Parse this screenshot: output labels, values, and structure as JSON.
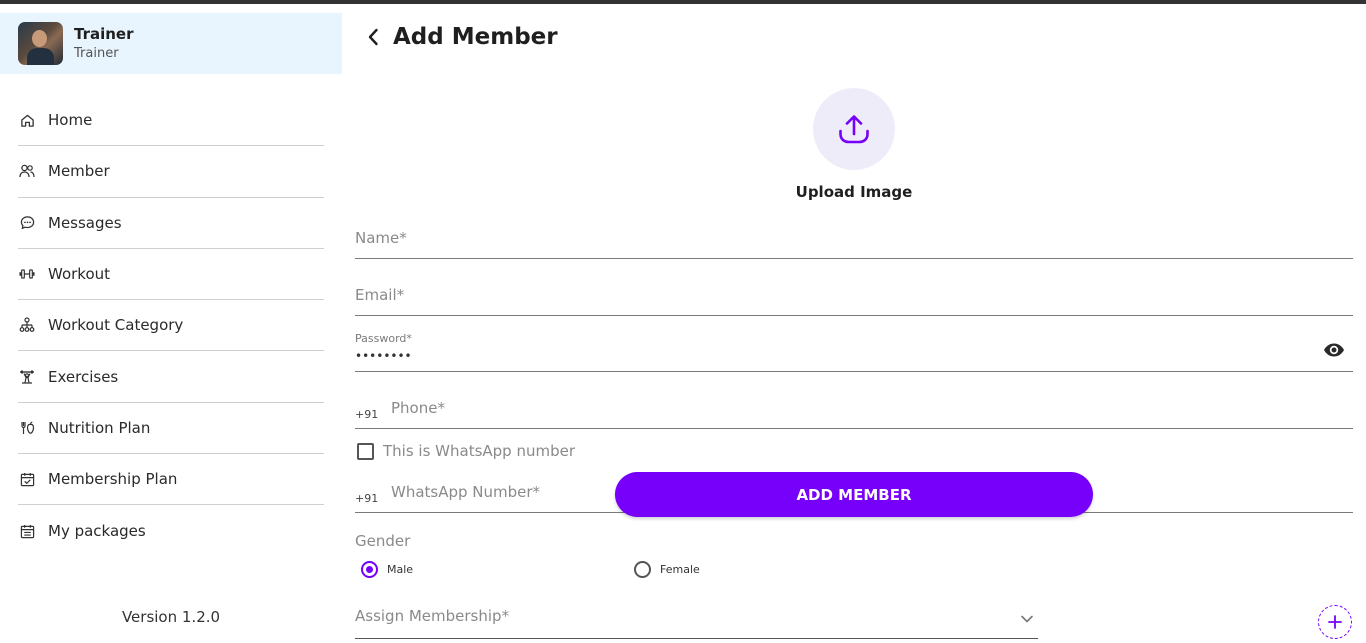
{
  "profile": {
    "name": "Trainer",
    "role": "Trainer"
  },
  "sidebar": {
    "items": [
      {
        "label": "Home",
        "icon": "home-icon"
      },
      {
        "label": "Member",
        "icon": "users-icon"
      },
      {
        "label": "Messages",
        "icon": "message-icon"
      },
      {
        "label": "Workout",
        "icon": "dumbbell-icon"
      },
      {
        "label": "Workout Category",
        "icon": "hierarchy-icon"
      },
      {
        "label": "Exercises",
        "icon": "exercise-icon"
      },
      {
        "label": "Nutrition Plan",
        "icon": "nutrition-icon"
      },
      {
        "label": "Membership Plan",
        "icon": "calendar-check-icon"
      },
      {
        "label": "My packages",
        "icon": "package-icon"
      }
    ],
    "version": "Version 1.2.0"
  },
  "main": {
    "title": "Add Member",
    "upload_label": "Upload Image",
    "fields": {
      "name_placeholder": "Name*",
      "email_placeholder": "Email*",
      "password_label": "Password*",
      "password_value": "••••••••",
      "phone_prefix": "+91",
      "phone_placeholder": "Phone*",
      "whatsapp_checkbox_label": "This is WhatsApp number",
      "whatsapp_prefix": "+91",
      "whatsapp_placeholder": "WhatsApp Number*"
    },
    "add_button_label": "ADD MEMBER",
    "gender": {
      "label": "Gender",
      "options": [
        "Male",
        "Female"
      ],
      "selected": "Male"
    },
    "membership_placeholder": "Assign Membership*"
  },
  "colors": {
    "accent": "#7600f9",
    "profile_bg": "#e8f4fe",
    "upload_bg": "#eeecf9"
  }
}
